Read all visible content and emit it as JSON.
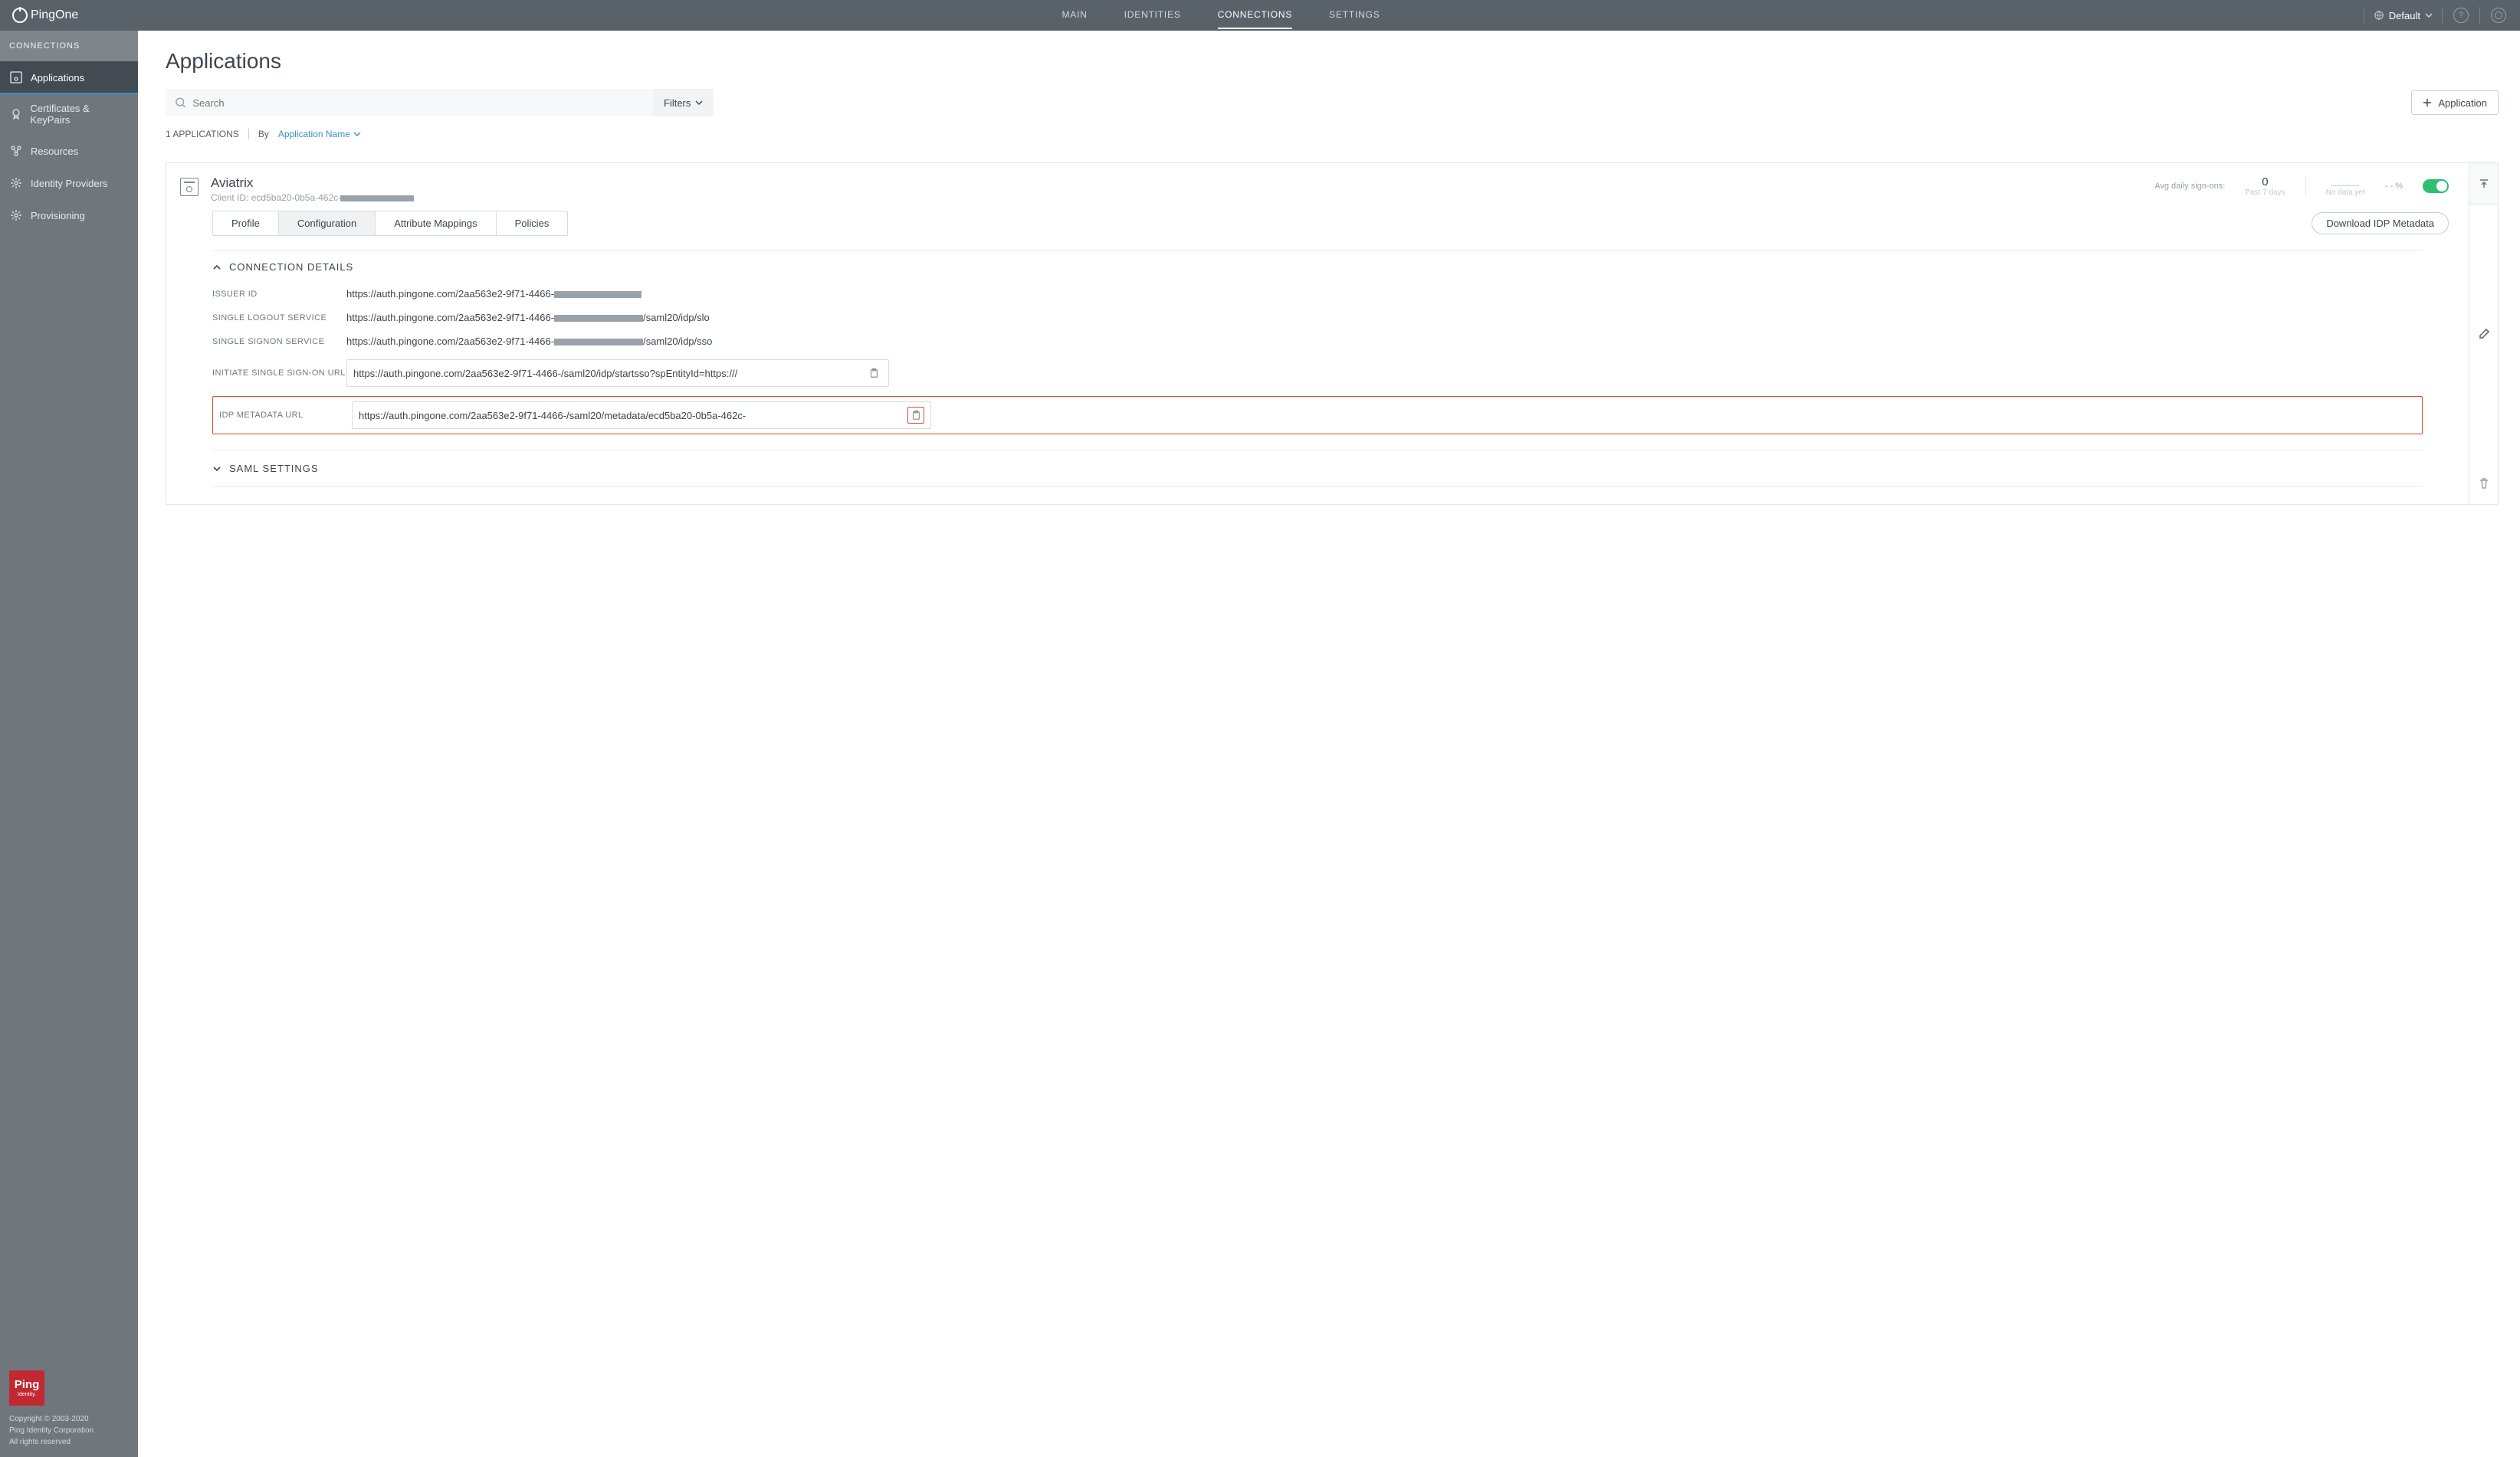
{
  "header": {
    "brand": "PingOne",
    "nav": [
      "MAIN",
      "IDENTITIES",
      "CONNECTIONS",
      "SETTINGS"
    ],
    "active_nav": 2,
    "environment": "Default"
  },
  "sidebar": {
    "section_label": "CONNECTIONS",
    "items": [
      {
        "label": "Applications",
        "icon": "apps"
      },
      {
        "label": "Certificates & KeyPairs",
        "icon": "cert"
      },
      {
        "label": "Resources",
        "icon": "resources"
      },
      {
        "label": "Identity Providers",
        "icon": "idp"
      },
      {
        "label": "Provisioning",
        "icon": "prov"
      }
    ],
    "active_item": 0,
    "footer_brand": "Ping",
    "footer_sub": "Identity.",
    "copyright_l1": "Copyright © 2003-2020",
    "copyright_l2": "Ping Identity Corporation",
    "copyright_l3": "All rights reserved"
  },
  "page": {
    "title": "Applications",
    "search_placeholder": "Search",
    "filters_label": "Filters",
    "add_button": "Application",
    "count_text": "1 APPLICATIONS",
    "sort_prefix": "By",
    "sort_value": "Application Name"
  },
  "app": {
    "name": "Aviatrix",
    "client_id_label": "Client ID:",
    "client_id_prefix": "ecd5ba20-0b5a-462c-",
    "stats": {
      "avg_label": "Avg daily sign-ons:",
      "avg_val": "0",
      "avg_sub": "Past 7 days",
      "chart_sub": "No data yet",
      "percent": "- - %"
    },
    "tabs": [
      "Profile",
      "Configuration",
      "Attribute Mappings",
      "Policies"
    ],
    "active_tab": 1,
    "download_btn": "Download IDP Metadata",
    "section_connection": "CONNECTION DETAILS",
    "section_saml": "SAML SETTINGS",
    "fields": {
      "issuer": {
        "label": "ISSUER ID",
        "prefix": "https://auth.pingone.com/2aa563e2-9f71-4466-",
        "suffix": ""
      },
      "slo": {
        "label": "SINGLE LOGOUT SERVICE",
        "prefix": "https://auth.pingone.com/2aa563e2-9f71-4466-",
        "suffix": "/saml20/idp/slo"
      },
      "sso": {
        "label": "SINGLE SIGNON SERVICE",
        "prefix": "https://auth.pingone.com/2aa563e2-9f71-4466-",
        "suffix": "/saml20/idp/sso"
      },
      "initiate": {
        "label": "INITIATE SINGLE SIGN-ON URL",
        "prefix": "https://auth.pingone.com/2aa563e2-9f71-4466-",
        "mid": "/saml20/idp/startsso?spEntityId=https://",
        "suffix": "/"
      },
      "metadata": {
        "label": "IDP METADATA URL",
        "prefix": "https://auth.pingone.com/2aa563e2-9f71-4466-",
        "mid": "/saml20/metadata/ecd5ba20-0b5a-462c-",
        "suffix": ""
      }
    }
  }
}
